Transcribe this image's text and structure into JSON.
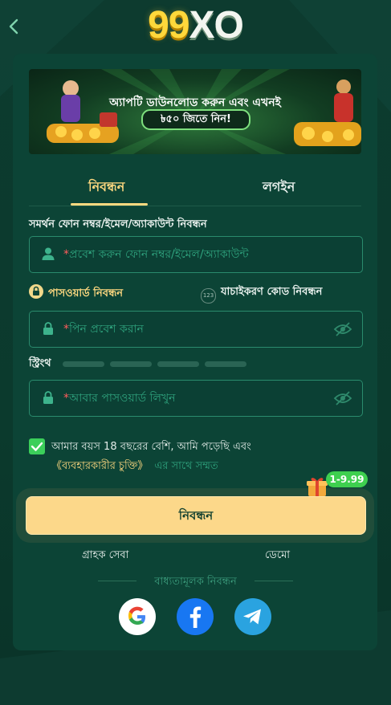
{
  "header": {
    "logo_text_a": "99",
    "logo_text_b": "XO"
  },
  "banner": {
    "title": "অ্যাপটি ডাউনলোড করুন এবং এখনই",
    "pill": "৳৫০ জিতে নিন!"
  },
  "tabs": {
    "register": "নিবন্ধন",
    "login": "লগইন"
  },
  "form": {
    "account_label": "সমর্থন ফোন নম্বর/ইমেল/অ্যাকাউন্ট নিবন্ধন",
    "account_placeholder": "প্রবেশ করুন ফোন নম্বর/ইমেল/অ্যাকাউন্ট",
    "option_password": "পাসওয়ার্ড নিবন্ধন",
    "option_code": "যাচাইকরণ কোড নিবন্ধন",
    "code_badge": "123",
    "pin_placeholder": "পিন প্রবেশ করান",
    "strength_label": "স্ট্রিংথ",
    "confirm_placeholder": "আবার পাসওয়ার্ড লিখুন",
    "required_mark": "*",
    "agree_line1": "আমার বয়স 18 বছরের বেশি, আমি পড়েছি এবং",
    "agree_link": "《ব্যবহারকারীর চুক্তি》",
    "agree_rest": "এর সাথে সম্মত",
    "agree_checked": true
  },
  "actions": {
    "register_button": "নিবন্ধন",
    "promo_badge": "1-9.99",
    "customer_service": "গ্রাহক সেবা",
    "demo": "ডেমো"
  },
  "social": {
    "heading": "বাধ্যতামূলক নিবন্ধন",
    "icons": [
      "google-icon",
      "facebook-icon",
      "telegram-icon"
    ]
  },
  "colors": {
    "accent": "#ffd980",
    "button": "#fcd88a",
    "field_border": "#2a8b6d",
    "background": "#0d3b2f"
  }
}
